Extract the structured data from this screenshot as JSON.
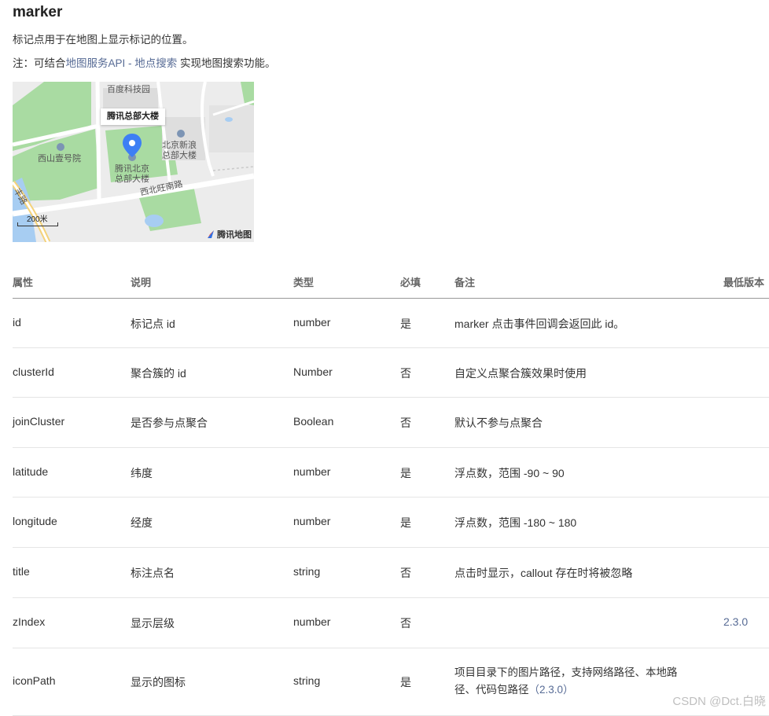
{
  "title": "marker",
  "description": "标记点用于在地图上显示标记的位置。",
  "note": {
    "prefix": "注：可结合",
    "link": "地图服务API - 地点搜索",
    "suffix": " 实现地图搜索功能。"
  },
  "map": {
    "labels": {
      "tech_park": "百度科技园",
      "xishan": "西山壹号院",
      "sina": "北京新浪\n总部大楼",
      "tencent_bj": "腾讯北京\n总部大楼",
      "road": "西北旺南路",
      "road_left": "丰路"
    },
    "callout": "腾讯总部大楼",
    "scale": "200米",
    "logo": "腾讯地图",
    "colors": {
      "green": "#a9dba2",
      "building": "#e3e3e3",
      "road": "#ffffff",
      "water": "#a7cdf2",
      "marker": "#3d7ff4"
    }
  },
  "table": {
    "headers": [
      "属性",
      "说明",
      "类型",
      "必填",
      "备注",
      "最低版本"
    ],
    "rows": [
      {
        "attr": "id",
        "desc": "标记点 id",
        "type": "number",
        "required": "是",
        "remark": "marker 点击事件回调会返回此 id。",
        "version": ""
      },
      {
        "attr": "clusterId",
        "desc": "聚合簇的 id",
        "type": "Number",
        "required": "否",
        "remark": "自定义点聚合簇效果时使用",
        "version": ""
      },
      {
        "attr": "joinCluster",
        "desc": "是否参与点聚合",
        "type": "Boolean",
        "required": "否",
        "remark": "默认不参与点聚合",
        "version": ""
      },
      {
        "attr": "latitude",
        "desc": "纬度",
        "type": "number",
        "required": "是",
        "remark": "浮点数，范围 -90 ~ 90",
        "version": ""
      },
      {
        "attr": "longitude",
        "desc": "经度",
        "type": "number",
        "required": "是",
        "remark": "浮点数，范围 -180 ~ 180",
        "version": ""
      },
      {
        "attr": "title",
        "desc": "标注点名",
        "type": "string",
        "required": "否",
        "remark": "点击时显示，callout 存在时将被忽略",
        "version": ""
      },
      {
        "attr": "zIndex",
        "desc": "显示层级",
        "type": "number",
        "required": "否",
        "remark": "",
        "version": "2.3.0"
      },
      {
        "attr": "iconPath",
        "desc": "显示的图标",
        "type": "string",
        "required": "是",
        "remark": "项目目录下的图片路径，支持网络路径、本地路径、代码包路径",
        "remark_version": "（2.3.0）",
        "version": ""
      }
    ]
  },
  "watermark": "CSDN @Dct.白晓"
}
